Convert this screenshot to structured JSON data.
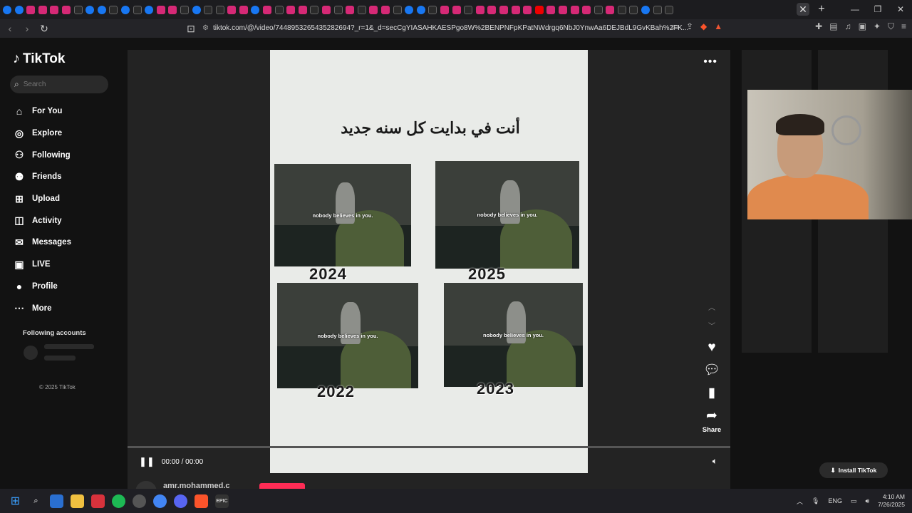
{
  "browser": {
    "tab_icons": [
      "facebook",
      "facebook",
      "instagram",
      "instagram",
      "instagram",
      "instagram",
      "tiktok",
      "facebook",
      "facebook",
      "tiktok",
      "facebook",
      "tiktok",
      "facebook",
      "instagram",
      "instagram",
      "tiktok",
      "facebook",
      "tiktok",
      "tiktok",
      "instagram",
      "instagram",
      "facebook",
      "instagram",
      "tiktok",
      "instagram",
      "instagram",
      "tiktok",
      "instagram",
      "tiktok",
      "instagram",
      "tiktok",
      "instagram",
      "instagram",
      "tiktok",
      "facebook",
      "facebook",
      "tiktok",
      "instagram",
      "instagram",
      "tiktok",
      "instagram",
      "instagram",
      "instagram",
      "instagram",
      "instagram",
      "youtube",
      "instagram",
      "instagram",
      "instagram",
      "instagram",
      "tiktok",
      "instagram",
      "tiktok",
      "tiktok",
      "facebook",
      "tiktok",
      "tiktok"
    ],
    "close_tab_label": "✕",
    "new_tab_label": "+",
    "url": "tiktok.com/@/video/7448953265435282694?_r=1&_d=secCgYIASAHKAESPgo8W%2BENPNFpKPatNWdrgq6NbJ0YnwAa6DEJBdL9GvKBah%2FK...",
    "window_controls": {
      "minimize": "—",
      "maximize": "❐",
      "close": "✕"
    }
  },
  "sidebar": {
    "brand": "TikTok",
    "search_placeholder": "Search",
    "nav": [
      {
        "label": "For You",
        "icon": "home-icon"
      },
      {
        "label": "Explore",
        "icon": "compass-icon"
      },
      {
        "label": "Following",
        "icon": "following-icon"
      },
      {
        "label": "Friends",
        "icon": "friends-icon"
      },
      {
        "label": "Upload",
        "icon": "upload-icon"
      },
      {
        "label": "Activity",
        "icon": "activity-icon"
      },
      {
        "label": "Messages",
        "icon": "messages-icon"
      },
      {
        "label": "LIVE",
        "icon": "live-icon"
      },
      {
        "label": "Profile",
        "icon": "profile-avatar"
      },
      {
        "label": "More",
        "icon": "more-icon"
      }
    ],
    "following_accounts_title": "Following accounts",
    "copyright": "© 2025 TikTok"
  },
  "video": {
    "title_arabic": "أنت في بدايت كل سنه جديد",
    "caption": "nobody believes in you.",
    "years": [
      "2024",
      "2025",
      "2022",
      "2023"
    ],
    "time": "00:00 / 00:00",
    "share_label": "Share",
    "author": "amr.mohammed.c"
  },
  "install_label": "Install TikTok",
  "taskbar": {
    "lang": "ENG",
    "time": "4:10 AM",
    "date": "7/26/2025"
  }
}
